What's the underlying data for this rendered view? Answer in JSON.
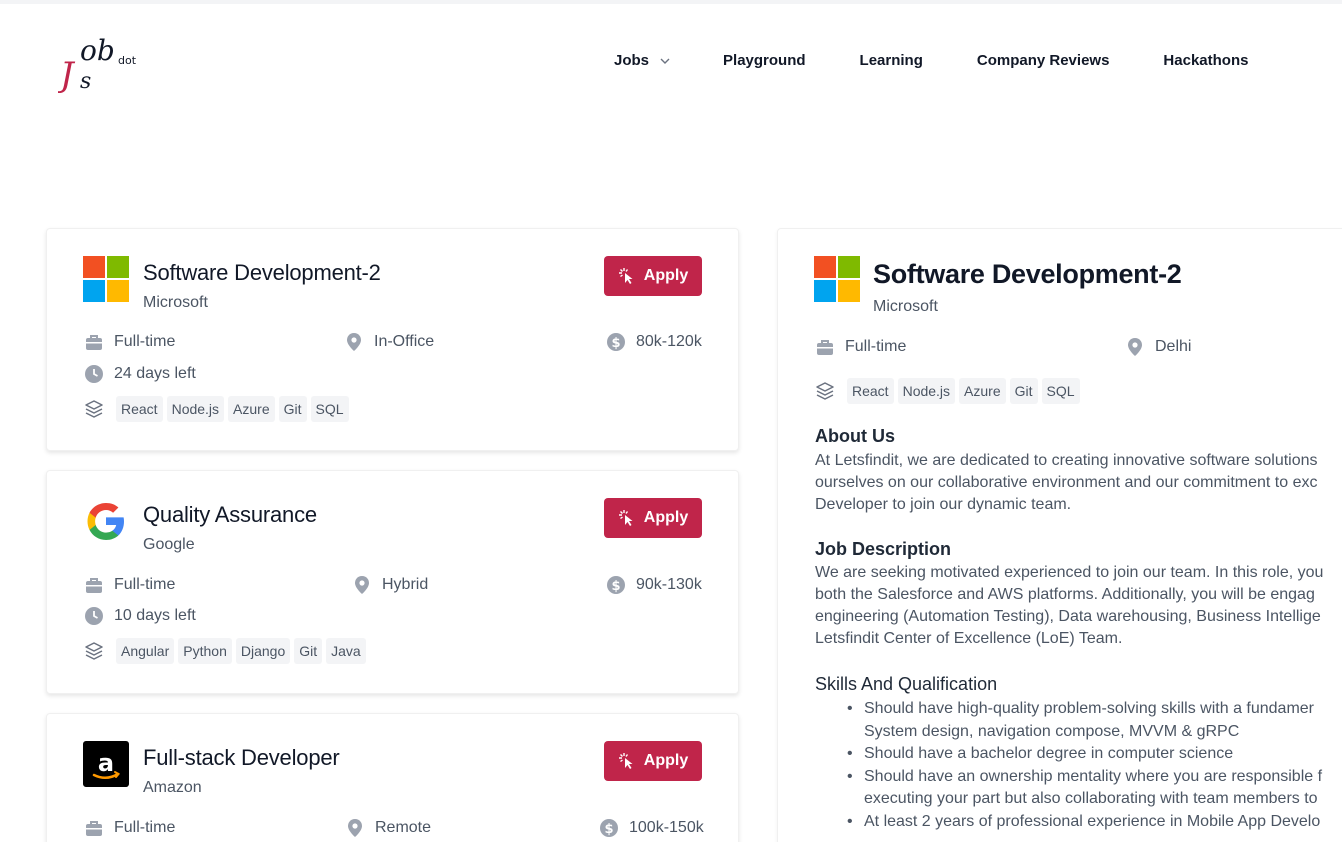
{
  "brand": {
    "logo_text": "Jobs",
    "logo_suffix": "dot",
    "accent": "#c0254a"
  },
  "nav": {
    "jobs": "Jobs",
    "playground": "Playground",
    "learning": "Learning",
    "company_reviews": "Company Reviews",
    "hackathons": "Hackathons"
  },
  "jobs": [
    {
      "title": "Software Development-2",
      "company": "Microsoft",
      "logo": "microsoft-logo",
      "type": "Full-time",
      "location": "In-Office",
      "salary": "80k-120k",
      "deadline": "24 days left",
      "skills": [
        "React",
        "Node.js",
        "Azure",
        "Git",
        "SQL"
      ],
      "apply_label": "Apply"
    },
    {
      "title": "Quality Assurance",
      "company": "Google",
      "logo": "google-logo",
      "type": "Full-time",
      "location": "Hybrid",
      "salary": "90k-130k",
      "deadline": "10 days left",
      "skills": [
        "Angular",
        "Python",
        "Django",
        "Git",
        "Java"
      ],
      "apply_label": "Apply"
    },
    {
      "title": "Full-stack Developer",
      "company": "Amazon",
      "logo": "amazon-logo",
      "type": "Full-time",
      "location": "Remote",
      "salary": "100k-150k",
      "apply_label": "Apply"
    }
  ],
  "detail": {
    "title": "Software Development-2",
    "company": "Microsoft",
    "type": "Full-time",
    "location": "Delhi",
    "skills": [
      "React",
      "Node.js",
      "Azure",
      "Git",
      "SQL"
    ],
    "about_heading": "About Us",
    "about_lines": [
      "At Letsfindit, we are dedicated to creating innovative software solutions",
      "ourselves on our collaborative environment and our commitment to exc",
      "Developer to join our dynamic team."
    ],
    "desc_heading": "Job Description",
    "desc_lines": [
      "We are seeking motivated experienced to join our team. In this role, you",
      "both the Salesforce and AWS platforms. Additionally, you will be engag",
      "engineering (Automation Testing), Data warehousing, Business Intellige",
      "Letsfindit Center of Excellence (LoE) Team."
    ],
    "skills_heading": "Skills And Qualification",
    "qualifications": [
      "Should have high-quality problem-solving skills with a fundamer",
      "System design, navigation compose, MVVM & gRPC",
      "Should have a bachelor degree in computer science",
      "Should have an ownership mentality where you are responsible f",
      "executing your part but also collaborating with team members to",
      "At least 2 years of professional experience in Mobile App Develo"
    ]
  }
}
